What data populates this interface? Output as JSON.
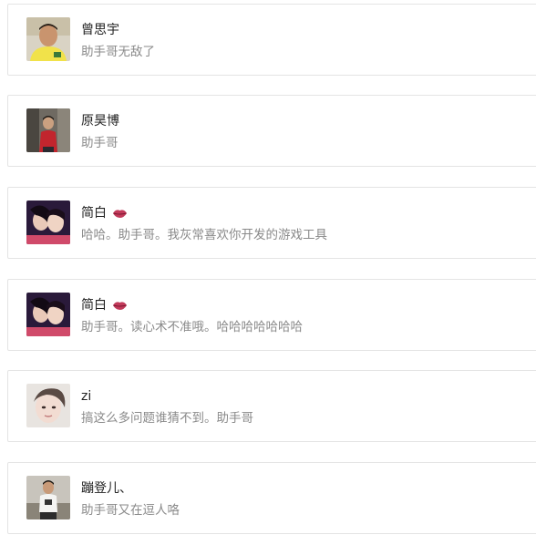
{
  "comments": [
    {
      "name": "曾思宇",
      "message": "助手哥无敌了",
      "avatar_icon": "avatar-man-yellow-shirt",
      "has_emoji": false
    },
    {
      "name": "原昊博",
      "message": "助手哥",
      "avatar_icon": "avatar-boy-red-shirt",
      "has_emoji": false
    },
    {
      "name": "简白",
      "message": "哈哈。助手哥。我灰常喜欢你开发的游戏工具",
      "avatar_icon": "avatar-couple-selfie",
      "has_emoji": true,
      "emoji_icon": "lips-icon"
    },
    {
      "name": "简白",
      "message": "助手哥。读心术不准哦。哈哈哈哈哈哈哈",
      "avatar_icon": "avatar-couple-selfie",
      "has_emoji": true,
      "emoji_icon": "lips-icon"
    },
    {
      "name": "zi",
      "message": "搞这么多问题谁猜不到。助手哥",
      "avatar_icon": "avatar-woman-portrait",
      "has_emoji": false
    },
    {
      "name": "蹦登儿、",
      "message": "助手哥又在逗人咯",
      "avatar_icon": "avatar-man-white-shirt",
      "has_emoji": false
    }
  ],
  "colors": {
    "border": "#e4e4e4",
    "name_text": "#222222",
    "message_text": "#8a8a8a"
  }
}
